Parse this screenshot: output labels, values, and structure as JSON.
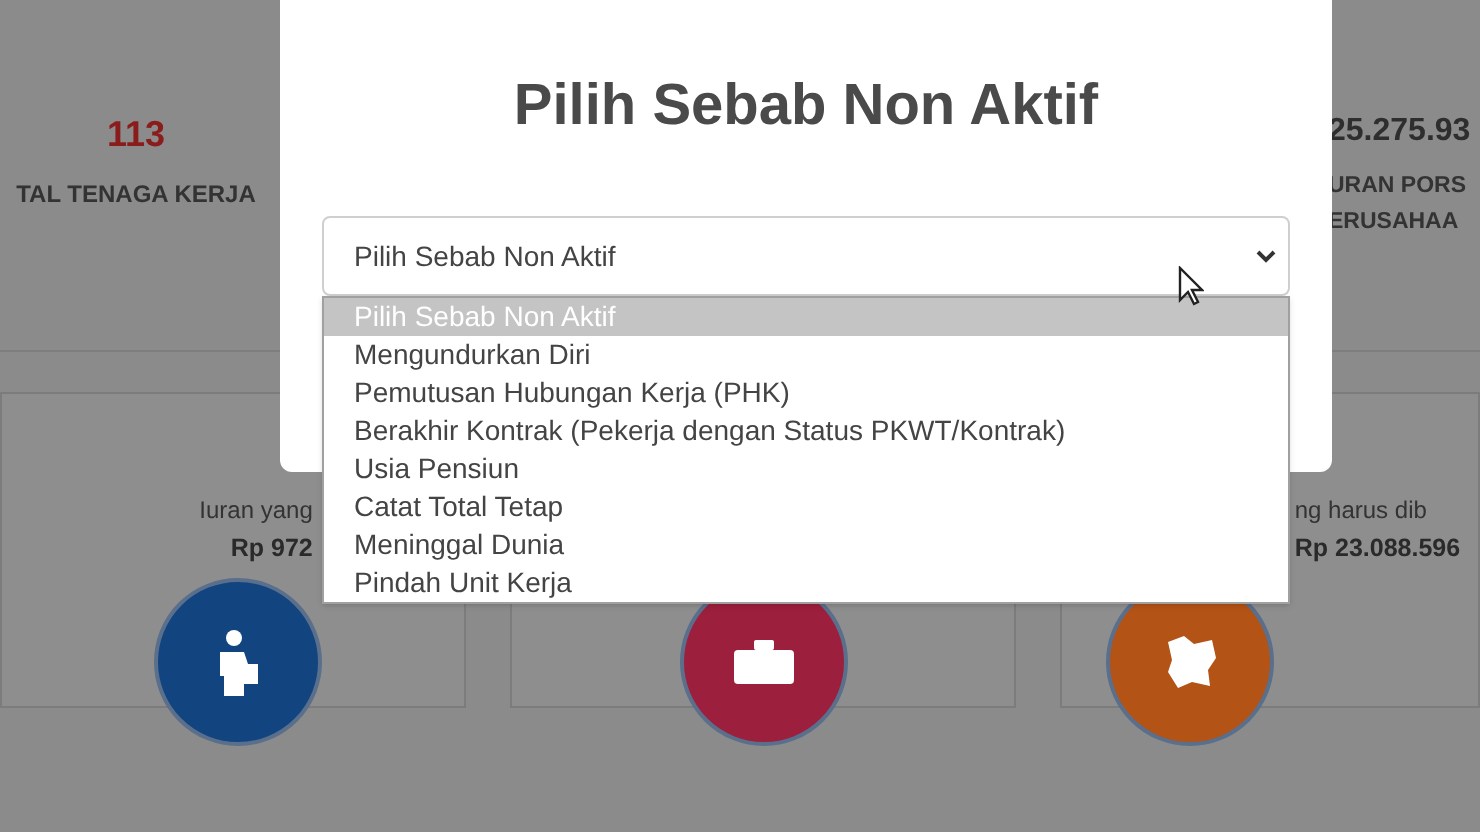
{
  "background": {
    "stats": [
      {
        "value": "113",
        "label_lines": [
          "TAL TENAGA KERJA"
        ]
      },
      {
        "value": "25.275.93",
        "label_lines": [
          "URAN PORS",
          "ERUSAHAA"
        ]
      }
    ],
    "cards": [
      {
        "kind": "person",
        "caption": "Iuran yang",
        "amount": "Rp 972",
        "color": "#12447f"
      },
      {
        "kind": "briefcase",
        "color": "#9c1f3d"
      },
      {
        "kind": "map",
        "caption": "ng harus dib",
        "amount": "Rp 23.088.596",
        "color": "#b45316"
      }
    ]
  },
  "modal": {
    "title": "Pilih Sebab Non Aktif",
    "select": {
      "value": "Pilih Sebab Non Aktif",
      "options": [
        {
          "label": "Pilih Sebab Non Aktif",
          "selected": true
        },
        {
          "label": "Mengundurkan Diri",
          "selected": false
        },
        {
          "label": "Pemutusan Hubungan Kerja (PHK)",
          "selected": false
        },
        {
          "label": "Berakhir Kontrak (Pekerja dengan Status PKWT/Kontrak)",
          "selected": false
        },
        {
          "label": "Usia Pensiun",
          "selected": false
        },
        {
          "label": "Catat Total Tetap",
          "selected": false
        },
        {
          "label": "Meninggal Dunia",
          "selected": false
        },
        {
          "label": "Pindah Unit Kerja",
          "selected": false
        }
      ]
    }
  }
}
